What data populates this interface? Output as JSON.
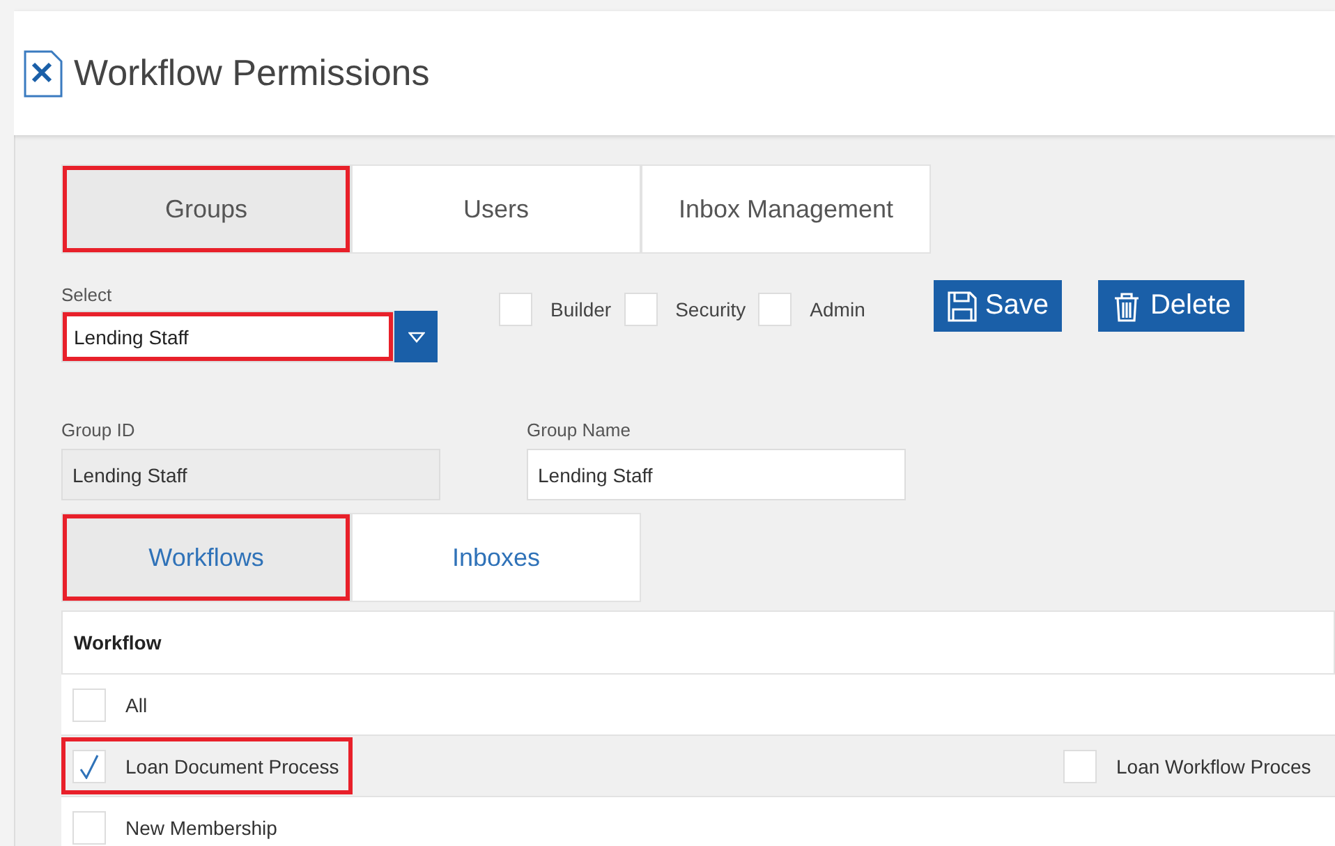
{
  "window": {
    "title": "Workflow Permissions"
  },
  "tabs": [
    {
      "label": "Groups",
      "selected": true,
      "highlighted": true
    },
    {
      "label": "Users",
      "selected": false,
      "highlighted": false
    },
    {
      "label": "Inbox Management",
      "selected": false,
      "highlighted": false
    }
  ],
  "group_select": {
    "label": "Select",
    "value": "Lending Staff",
    "highlighted": true
  },
  "roles": [
    {
      "label": "Builder",
      "checked": false
    },
    {
      "label": "Security",
      "checked": false
    },
    {
      "label": "Admin",
      "checked": false
    }
  ],
  "buttons": [
    {
      "label": "Save",
      "kind": "save"
    },
    {
      "label": "Delete",
      "kind": "delete"
    }
  ],
  "group_id": {
    "label": "Group ID",
    "value": "Lending Staff",
    "disabled": true
  },
  "group_name": {
    "label": "Group Name",
    "value": "Lending Staff",
    "disabled": false
  },
  "subtabs": [
    {
      "label": "Workflows",
      "selected": true,
      "highlighted": true
    },
    {
      "label": "Inboxes",
      "selected": false,
      "highlighted": false
    }
  ],
  "table": {
    "column": "Workflow",
    "rows": [
      {
        "items": [
          {
            "label": "All",
            "checked": false,
            "highlighted": false
          }
        ]
      },
      {
        "items": [
          {
            "label": "Loan Document Process",
            "checked": true,
            "highlighted": true
          },
          {
            "label": "Loan Workflow Proces",
            "checked": false,
            "highlighted": false
          }
        ]
      },
      {
        "items": [
          {
            "label": "New Membership",
            "checked": false,
            "highlighted": false
          }
        ]
      }
    ]
  }
}
